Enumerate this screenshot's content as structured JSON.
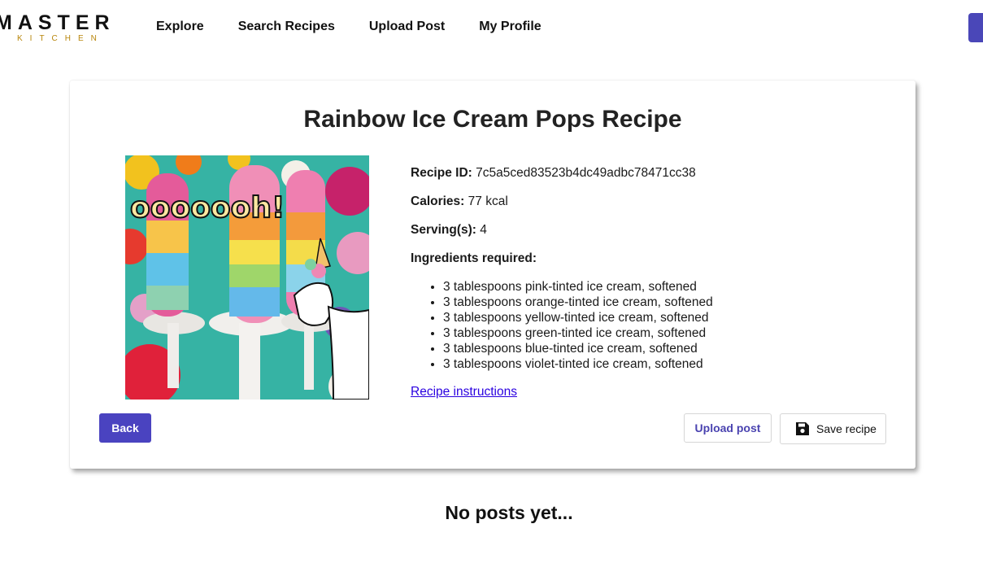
{
  "header": {
    "logo_main": "MASTER",
    "logo_sub": "KITCHEN",
    "nav": [
      "Explore",
      "Search Recipes",
      "Upload Post",
      "My Profile"
    ]
  },
  "recipe": {
    "title": "Rainbow Ice Cream Pops Recipe",
    "image_text": "ooooooh!",
    "id_label": "Recipe ID:",
    "id_value": "7c5a5ced83523b4dc49adbc78471cc38",
    "calories_label": "Calories:",
    "calories_value": "77 kcal",
    "servings_label": "Serving(s):",
    "servings_value": "4",
    "ingredients_label": "Ingredients required:",
    "ingredients": [
      "3 tablespoons pink-tinted ice cream, softened",
      "3 tablespoons orange-tinted ice cream, softened",
      "3 tablespoons yellow-tinted ice cream, softened",
      "3 tablespoons green-tinted ice cream, softened",
      "3 tablespoons blue-tinted ice cream, softened",
      "3 tablespoons violet-tinted ice cream, softened"
    ],
    "instructions_link": "Recipe instructions"
  },
  "actions": {
    "back": "Back",
    "upload": "Upload post",
    "save": "Save recipe"
  },
  "posts": {
    "empty_text": "No posts yet..."
  },
  "colors": {
    "accent": "#4a43c0",
    "link": "#2a00e0",
    "logo_gold": "#b8860b"
  }
}
